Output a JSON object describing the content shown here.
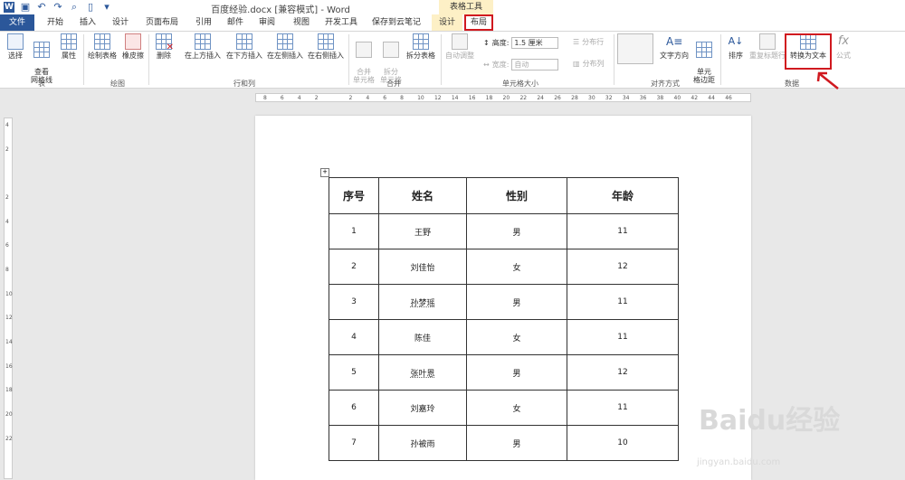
{
  "window": {
    "title": "百度经验.docx [兼容模式] - Word",
    "context_group": "表格工具"
  },
  "tabs": [
    {
      "label": "文件"
    },
    {
      "label": "开始"
    },
    {
      "label": "插入"
    },
    {
      "label": "设计"
    },
    {
      "label": "页面布局"
    },
    {
      "label": "引用"
    },
    {
      "label": "邮件"
    },
    {
      "label": "审阅"
    },
    {
      "label": "视图"
    },
    {
      "label": "开发工具"
    },
    {
      "label": "保存到云笔记"
    },
    {
      "label": "设计"
    },
    {
      "label": "布局"
    }
  ],
  "ribbon": {
    "groups": {
      "table": "表",
      "draw": "绘图",
      "rows_cols": "行和列",
      "merge": "合并",
      "cell_size": "单元格大小",
      "align": "对齐方式",
      "data": "数据"
    },
    "buttons": {
      "select": "选择",
      "view_grid": "查看\n网格线",
      "properties": "属性",
      "draw_table": "绘制表格",
      "eraser": "橡皮擦",
      "delete": "删除",
      "insert_above": "在上方插入",
      "insert_below": "在下方插入",
      "insert_left": "在左侧插入",
      "insert_right": "在右侧插入",
      "merge_cells": "合并\n单元格",
      "split_cells": "拆分\n单元格",
      "split_table": "拆分表格",
      "autofit": "自动调整",
      "text_direction": "文字方向",
      "cell_margins": "单元\n格边距",
      "sort": "排序",
      "repeat_header": "重复标题行",
      "convert_text": "转换为文本",
      "formula": "公式"
    },
    "cell_size": {
      "height_label": "高度:",
      "height_value": "1.5 厘米",
      "width_label": "宽度:",
      "width_value": "自动",
      "distribute_rows": "分布行",
      "distribute_cols": "分布列"
    }
  },
  "ruler_h": [
    "8",
    "6",
    "4",
    "2",
    "",
    "2",
    "4",
    "6",
    "8",
    "10",
    "12",
    "14",
    "16",
    "18",
    "20",
    "22",
    "24",
    "26",
    "28",
    "30",
    "32",
    "34",
    "36",
    "38",
    "40",
    "42",
    "44",
    "46"
  ],
  "ruler_v": [
    "4",
    "2",
    "",
    "2",
    "4",
    "6",
    "8",
    "10",
    "12",
    "14",
    "16",
    "18",
    "20",
    "22"
  ],
  "table": {
    "headers": [
      "序号",
      "姓名",
      "性别",
      "年龄"
    ],
    "rows": [
      [
        "1",
        "王野",
        "男",
        "11"
      ],
      [
        "2",
        "刘佳怡",
        "女",
        "12"
      ],
      [
        "3",
        "孙梦瑶",
        "男",
        "11"
      ],
      [
        "4",
        "陈佳",
        "女",
        "11"
      ],
      [
        "5",
        "张叶恩",
        "男",
        "12"
      ],
      [
        "6",
        "刘嘉玲",
        "女",
        "11"
      ],
      [
        "7",
        "孙被雨",
        "男",
        "10"
      ]
    ]
  },
  "watermark": {
    "main": "Baidu经验",
    "sub": "jingyan.baidu.com"
  },
  "colors": {
    "word_blue": "#2b579a",
    "highlight_red": "#d0191f",
    "context_tab": "#fdf0c6"
  }
}
